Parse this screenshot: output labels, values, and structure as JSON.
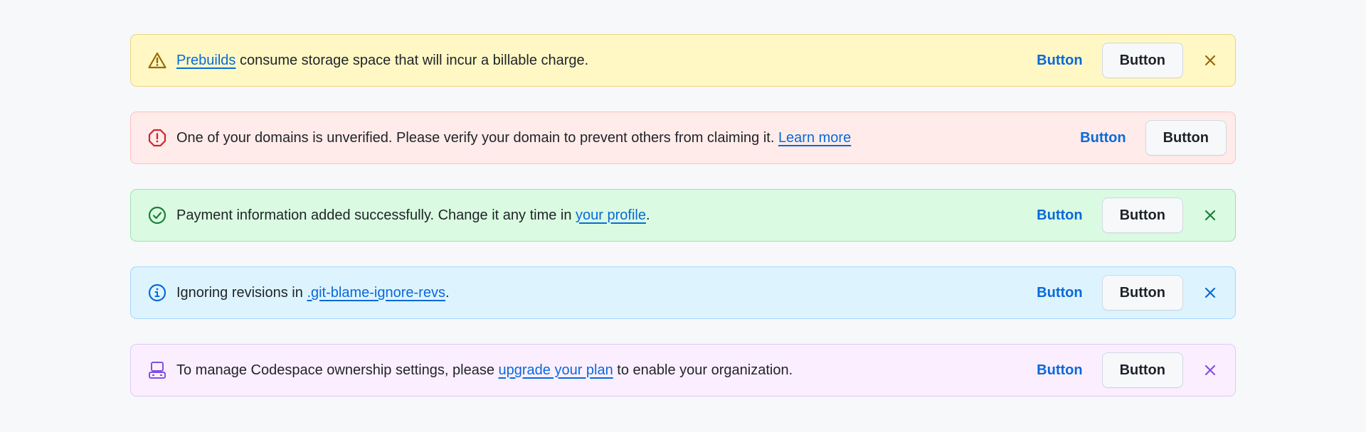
{
  "banners": [
    {
      "variant": "warning",
      "icon": "alert-triangle-icon",
      "before": "",
      "link": "Prebuilds",
      "after": " consume storage space that will incur a billable charge.",
      "primary": "Button",
      "secondary": "Button",
      "dismissible": true,
      "bg": "#fff8c5",
      "border": "#ecd37f",
      "icon_color": "#9a6700"
    },
    {
      "variant": "critical",
      "icon": "stop-octagon-icon",
      "before": "One of your domains is unverified. Please verify your domain to prevent others from claiming it. ",
      "link": "Learn more",
      "after": "",
      "primary": "Button",
      "secondary": "Button",
      "dismissible": false,
      "bg": "#ffebe9",
      "border": "#ffc1c0",
      "icon_color": "#d1242f"
    },
    {
      "variant": "success",
      "icon": "check-circle-icon",
      "before": "Payment information added successfully. Change it any time in ",
      "link": "your profile",
      "after": ".",
      "primary": "Button",
      "secondary": "Button",
      "dismissible": true,
      "bg": "#dafbe1",
      "border": "#9fdfaf",
      "icon_color": "#1a7f37"
    },
    {
      "variant": "info",
      "icon": "info-icon",
      "before": "Ignoring revisions in ",
      "link": ".git-blame-ignore-revs",
      "after": ".",
      "primary": "Button",
      "secondary": "Button",
      "dismissible": true,
      "bg": "#ddf4ff",
      "border": "#a6d6ff",
      "icon_color": "#0969da"
    },
    {
      "variant": "upsell",
      "icon": "server-icon",
      "before": "To manage Codespace ownership settings, please ",
      "link": "upgrade your plan",
      "after": " to enable your organization.",
      "primary": "Button",
      "secondary": "Button",
      "dismissible": true,
      "bg": "#fbefff",
      "border": "#e0c8ff",
      "icon_color": "#8250df"
    }
  ]
}
